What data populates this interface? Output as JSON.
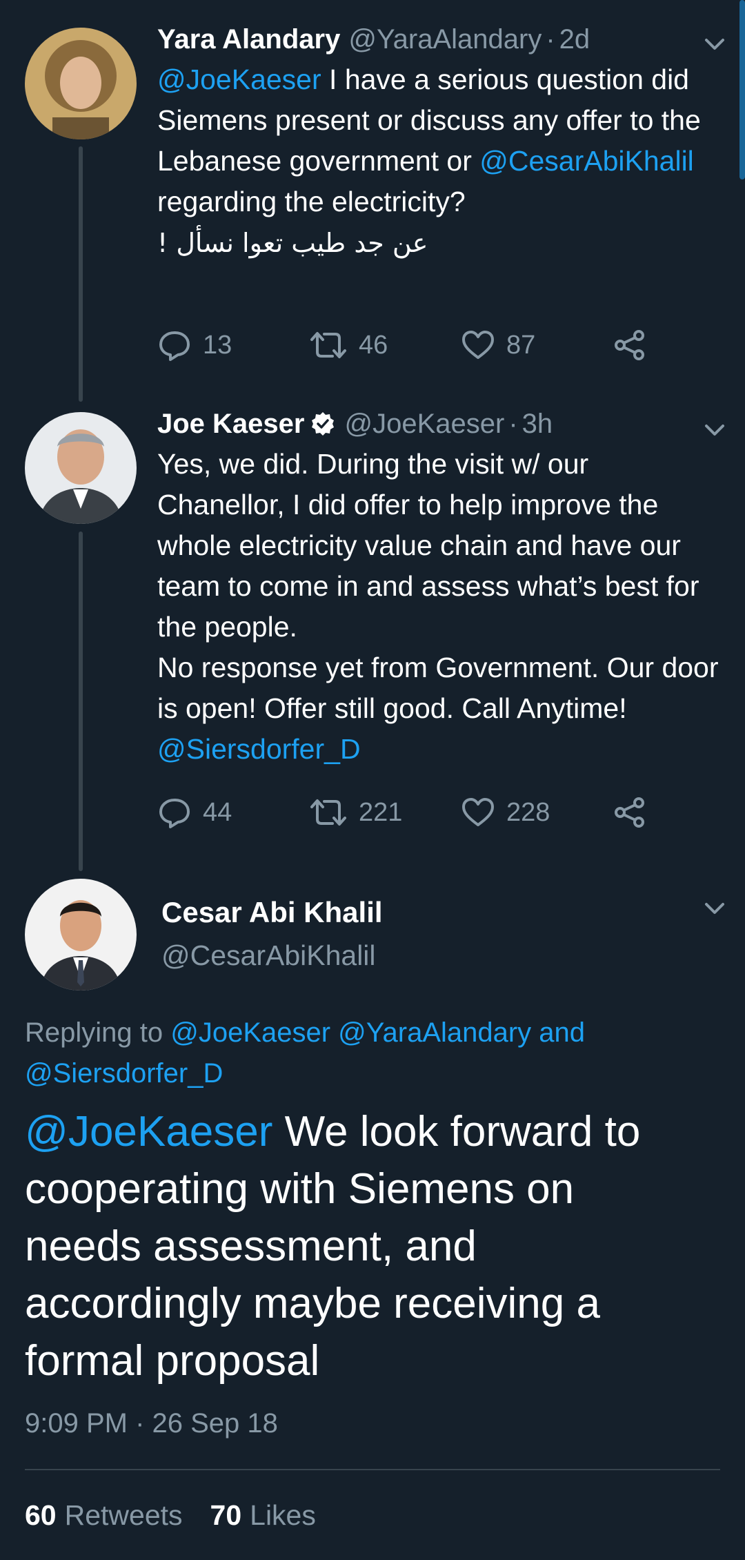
{
  "tweets": [
    {
      "name": "Yara Alandary",
      "handle": "@YaraAlandary",
      "sep": "·",
      "time": "2d",
      "mention1": "@JoeKaeser",
      "text1": " I have a serious question did Siemens present or discuss any offer to the Lebanese government or ",
      "mention2": "@CesarAbiKhalil",
      "text2": " regarding the electricity?",
      "arabic": "عن جد طيب تعوا نسأل !",
      "replies": "13",
      "retweets": "46",
      "likes": "87"
    },
    {
      "name": "Joe Kaeser",
      "handle": "@JoeKaeser",
      "sep": "·",
      "time": "3h",
      "text1": "Yes, we did. During the visit w/ our Chanellor, I did offer to help improve the whole electricity value chain and have our team to come in and assess what’s best for the people.",
      "text2": "No response yet from Government. Our door is open! Offer still good. Call Anytime! ",
      "mention1": "@Siersdorfer_D",
      "replies": "44",
      "retweets": "221",
      "likes": "228"
    }
  ],
  "main_tweet": {
    "name": "Cesar Abi Khalil",
    "handle": "@CesarAbiKhalil",
    "replying_prefix": "Replying to ",
    "replying_mentions": "@JoeKaeser @YaraAlandary and",
    "replying_mention2": "@Siersdorfer_D",
    "mention": "@JoeKaeser",
    "text": " We look forward to cooperating with Siemens on needs assessment, and accordingly maybe receiving a formal proposal",
    "timestamp": "9:09 PM · 26 Sep 18",
    "retweets_count": "60",
    "retweets_label": "Retweets",
    "likes_count": "70",
    "likes_label": "Likes"
  },
  "colors": {
    "background": "#15202b",
    "accent": "#1da1f2",
    "secondary_text": "#8899a6",
    "divider": "#38444d"
  },
  "icons": [
    "reply-icon",
    "retweet-icon",
    "like-icon",
    "share-icon",
    "chevron-down-icon",
    "verified-badge-icon"
  ]
}
